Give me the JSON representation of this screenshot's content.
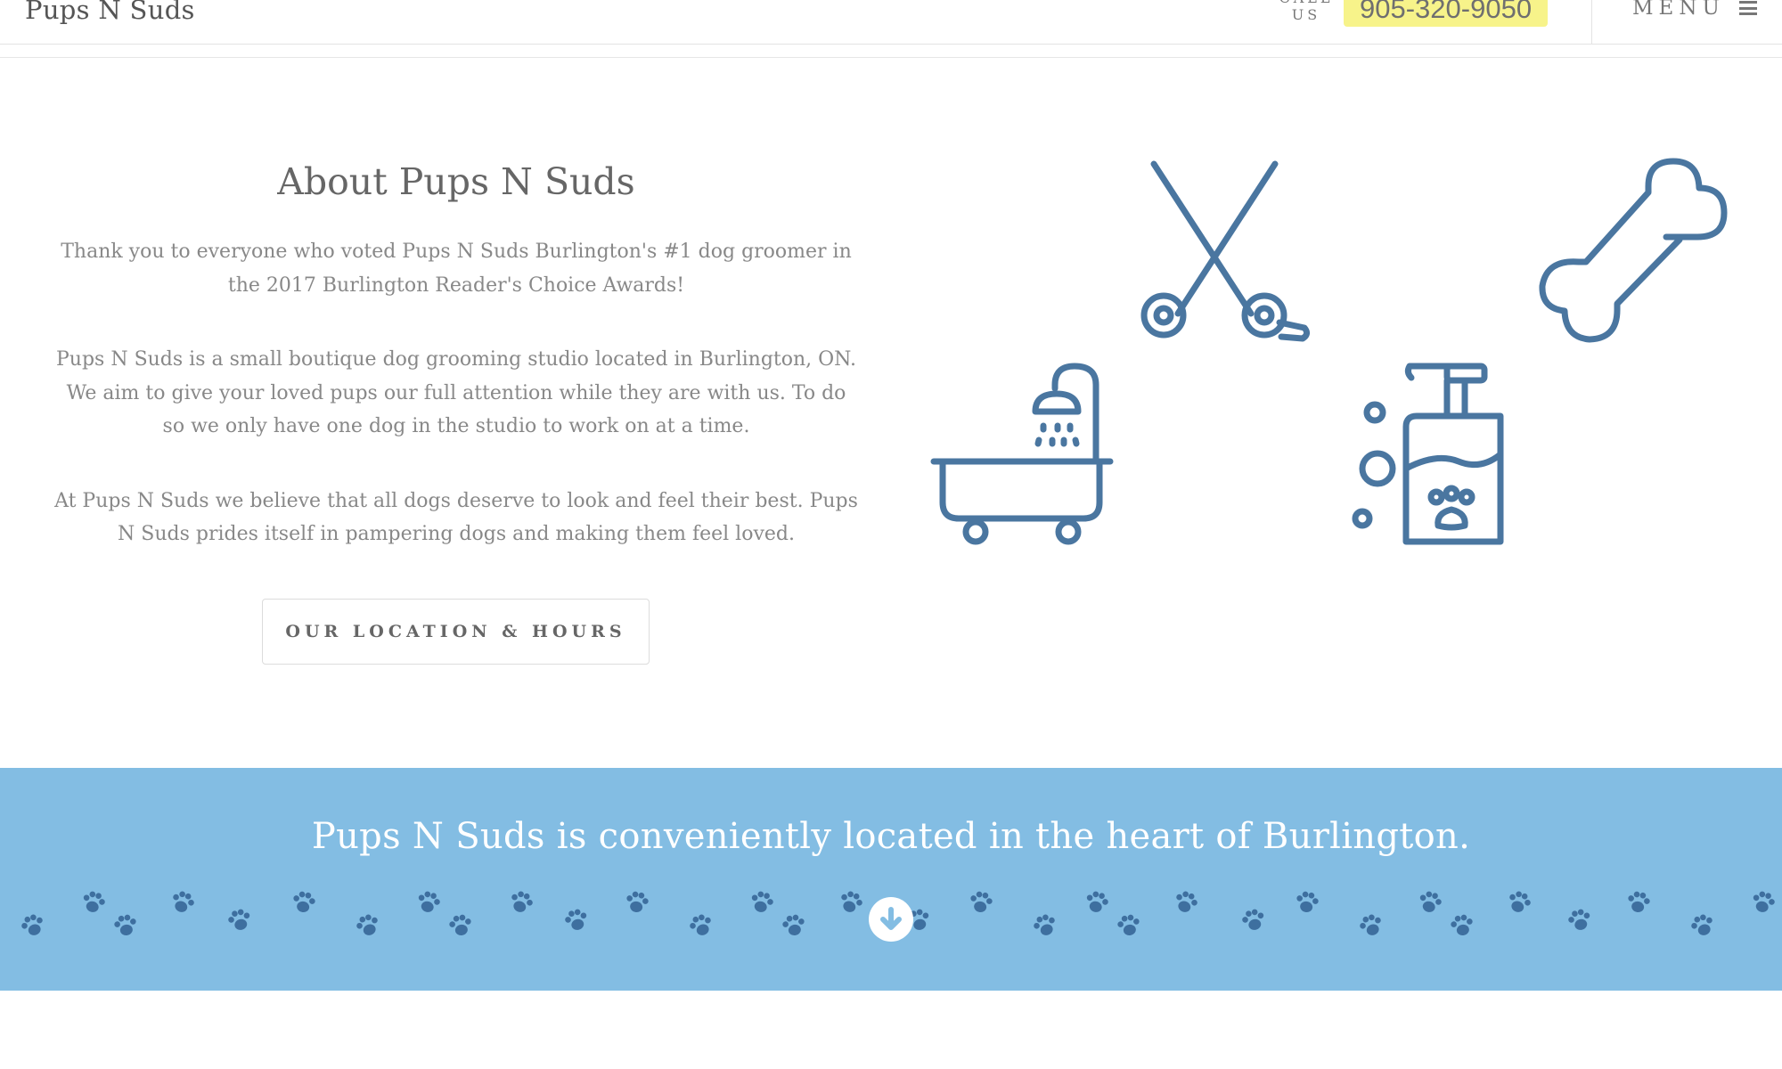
{
  "header": {
    "site_title": "Pups N Suds",
    "call_label": "CALL US",
    "phone": "905-320-9050",
    "menu_label": "MENU"
  },
  "about": {
    "heading": "About Pups N Suds",
    "paragraphs": [
      "Thank you to everyone who voted Pups N Suds Burlington's #1 dog groomer in the 2017 Burlington Reader's Choice Awards!",
      "Pups N Suds is a small boutique dog grooming studio located in Burlington, ON. We aim to give your loved pups our full attention while they are with us. To do so we only have one dog in the studio to work on at a time.",
      "At Pups N Suds we believe that all dogs deserve to look and feel their best. Pups N Suds prides itself in pampering dogs and making them feel loved."
    ],
    "button_label": "OUR LOCATION & HOURS"
  },
  "icons": [
    "scissors-icon",
    "bone-icon",
    "bathtub-icon",
    "shampoo-bottle-icon"
  ],
  "banner": {
    "text": "Pups N Suds is conveniently located in the heart of Burlington."
  },
  "colors": {
    "accent_blue": "#83bde3",
    "icon_blue": "#4a76a0",
    "phone_highlight": "#f7f38a"
  }
}
